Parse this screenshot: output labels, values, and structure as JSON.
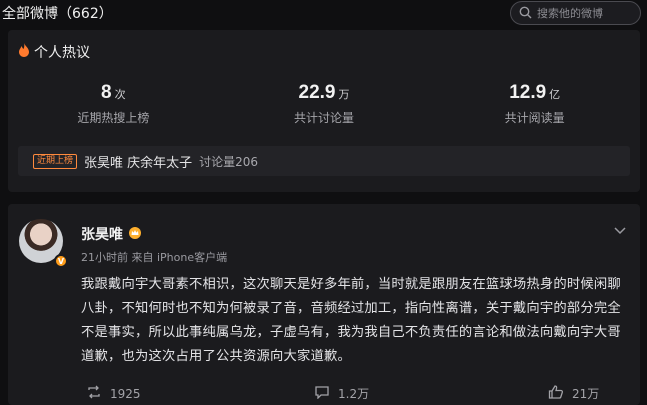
{
  "topbar": {
    "title": "全部微博（662）",
    "search_placeholder": "搜索他的微博"
  },
  "hot": {
    "title": "个人热议",
    "stats": [
      {
        "value": "8",
        "unit": "次",
        "label": "近期热搜上榜"
      },
      {
        "value": "22.9",
        "unit": "万",
        "label": "共计讨论量"
      },
      {
        "value": "12.9",
        "unit": "亿",
        "label": "共计阅读量"
      }
    ],
    "recent": {
      "badge": "近期上榜",
      "topic": "张昊唯 庆余年太子",
      "count": "讨论量206"
    }
  },
  "post": {
    "username": "张昊唯",
    "time_source": "21小时前  来自 iPhone客户端",
    "content": "我跟戴向宇大哥素不相识，这次聊天是好多年前，当时就是跟朋友在篮球场热身的时候闲聊八卦，不知何时也不知为何被录了音，音频经过加工，指向性离谱，关于戴向宇的部分完全不是事实，所以此事纯属乌龙，子虚乌有，我为我自己不负责任的言论和做法向戴向宇大哥道歉，也为这次占用了公共资源向大家道歉。",
    "reposts": "1925",
    "comments": "1.2万",
    "likes": "21万"
  },
  "colors": {
    "background": "#0f0f11",
    "card": "#1b1b1e",
    "accent": "#ff8a3d",
    "verified": "#ff9d1a"
  },
  "icons": [
    "search-icon",
    "fire-icon",
    "crown-icon",
    "chevron-down-icon",
    "repost-icon",
    "comment-icon",
    "like-icon"
  ]
}
